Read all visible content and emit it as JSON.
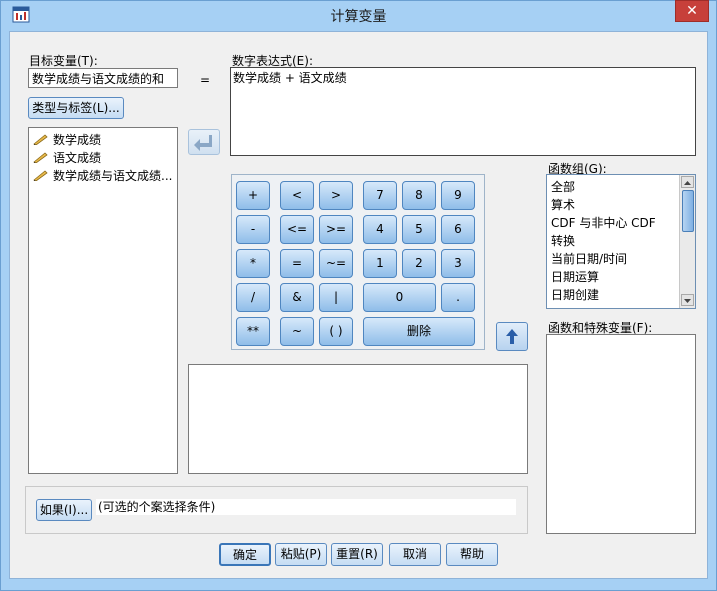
{
  "window": {
    "title": "计算变量",
    "close_glyph": "✕"
  },
  "target_var": {
    "label": "目标变量(T):",
    "value": "数学成绩与语文成绩的和"
  },
  "equals_sign": "=",
  "type_label_button": "类型与标签(L)...",
  "variables": [
    {
      "label": "数学成绩",
      "icon": "ruler-pencil-icon"
    },
    {
      "label": "语文成绩",
      "icon": "ruler-pencil-icon"
    },
    {
      "label": "数学成绩与语文成绩...",
      "icon": "ruler-pencil-icon"
    }
  ],
  "expression": {
    "label": "数字表达式(E):",
    "value": "数学成绩 + 语文成绩"
  },
  "keypad": {
    "ops": [
      [
        "+",
        "<",
        ">"
      ],
      [
        "-",
        "<=",
        ">="
      ],
      [
        "*",
        "=",
        "~="
      ],
      [
        "/",
        "&",
        "|"
      ],
      [
        "**",
        "~",
        "( )"
      ]
    ],
    "digits": [
      [
        "7",
        "8",
        "9"
      ],
      [
        "4",
        "5",
        "6"
      ],
      [
        "1",
        "2",
        "3"
      ]
    ],
    "zero": "0",
    "dot": ".",
    "delete": "删除"
  },
  "function_group": {
    "label": "函数组(G):",
    "items": [
      "全部",
      "算术",
      "CDF 与非中心 CDF",
      "转换",
      "当前日期/时间",
      "日期运算",
      "日期创建"
    ]
  },
  "functions_special": {
    "label": "函数和特殊变量(F):"
  },
  "if_button": "如果(I)...",
  "if_hint": "(可选的个案选择条件)",
  "footer": {
    "ok": "确定",
    "paste": "粘贴(P)",
    "reset": "重置(R)",
    "cancel": "取消",
    "help": "帮助"
  },
  "colors": {
    "title_bar": "#a6d0f4",
    "close": "#c7403a",
    "keypad_button": "#8fbde9"
  }
}
